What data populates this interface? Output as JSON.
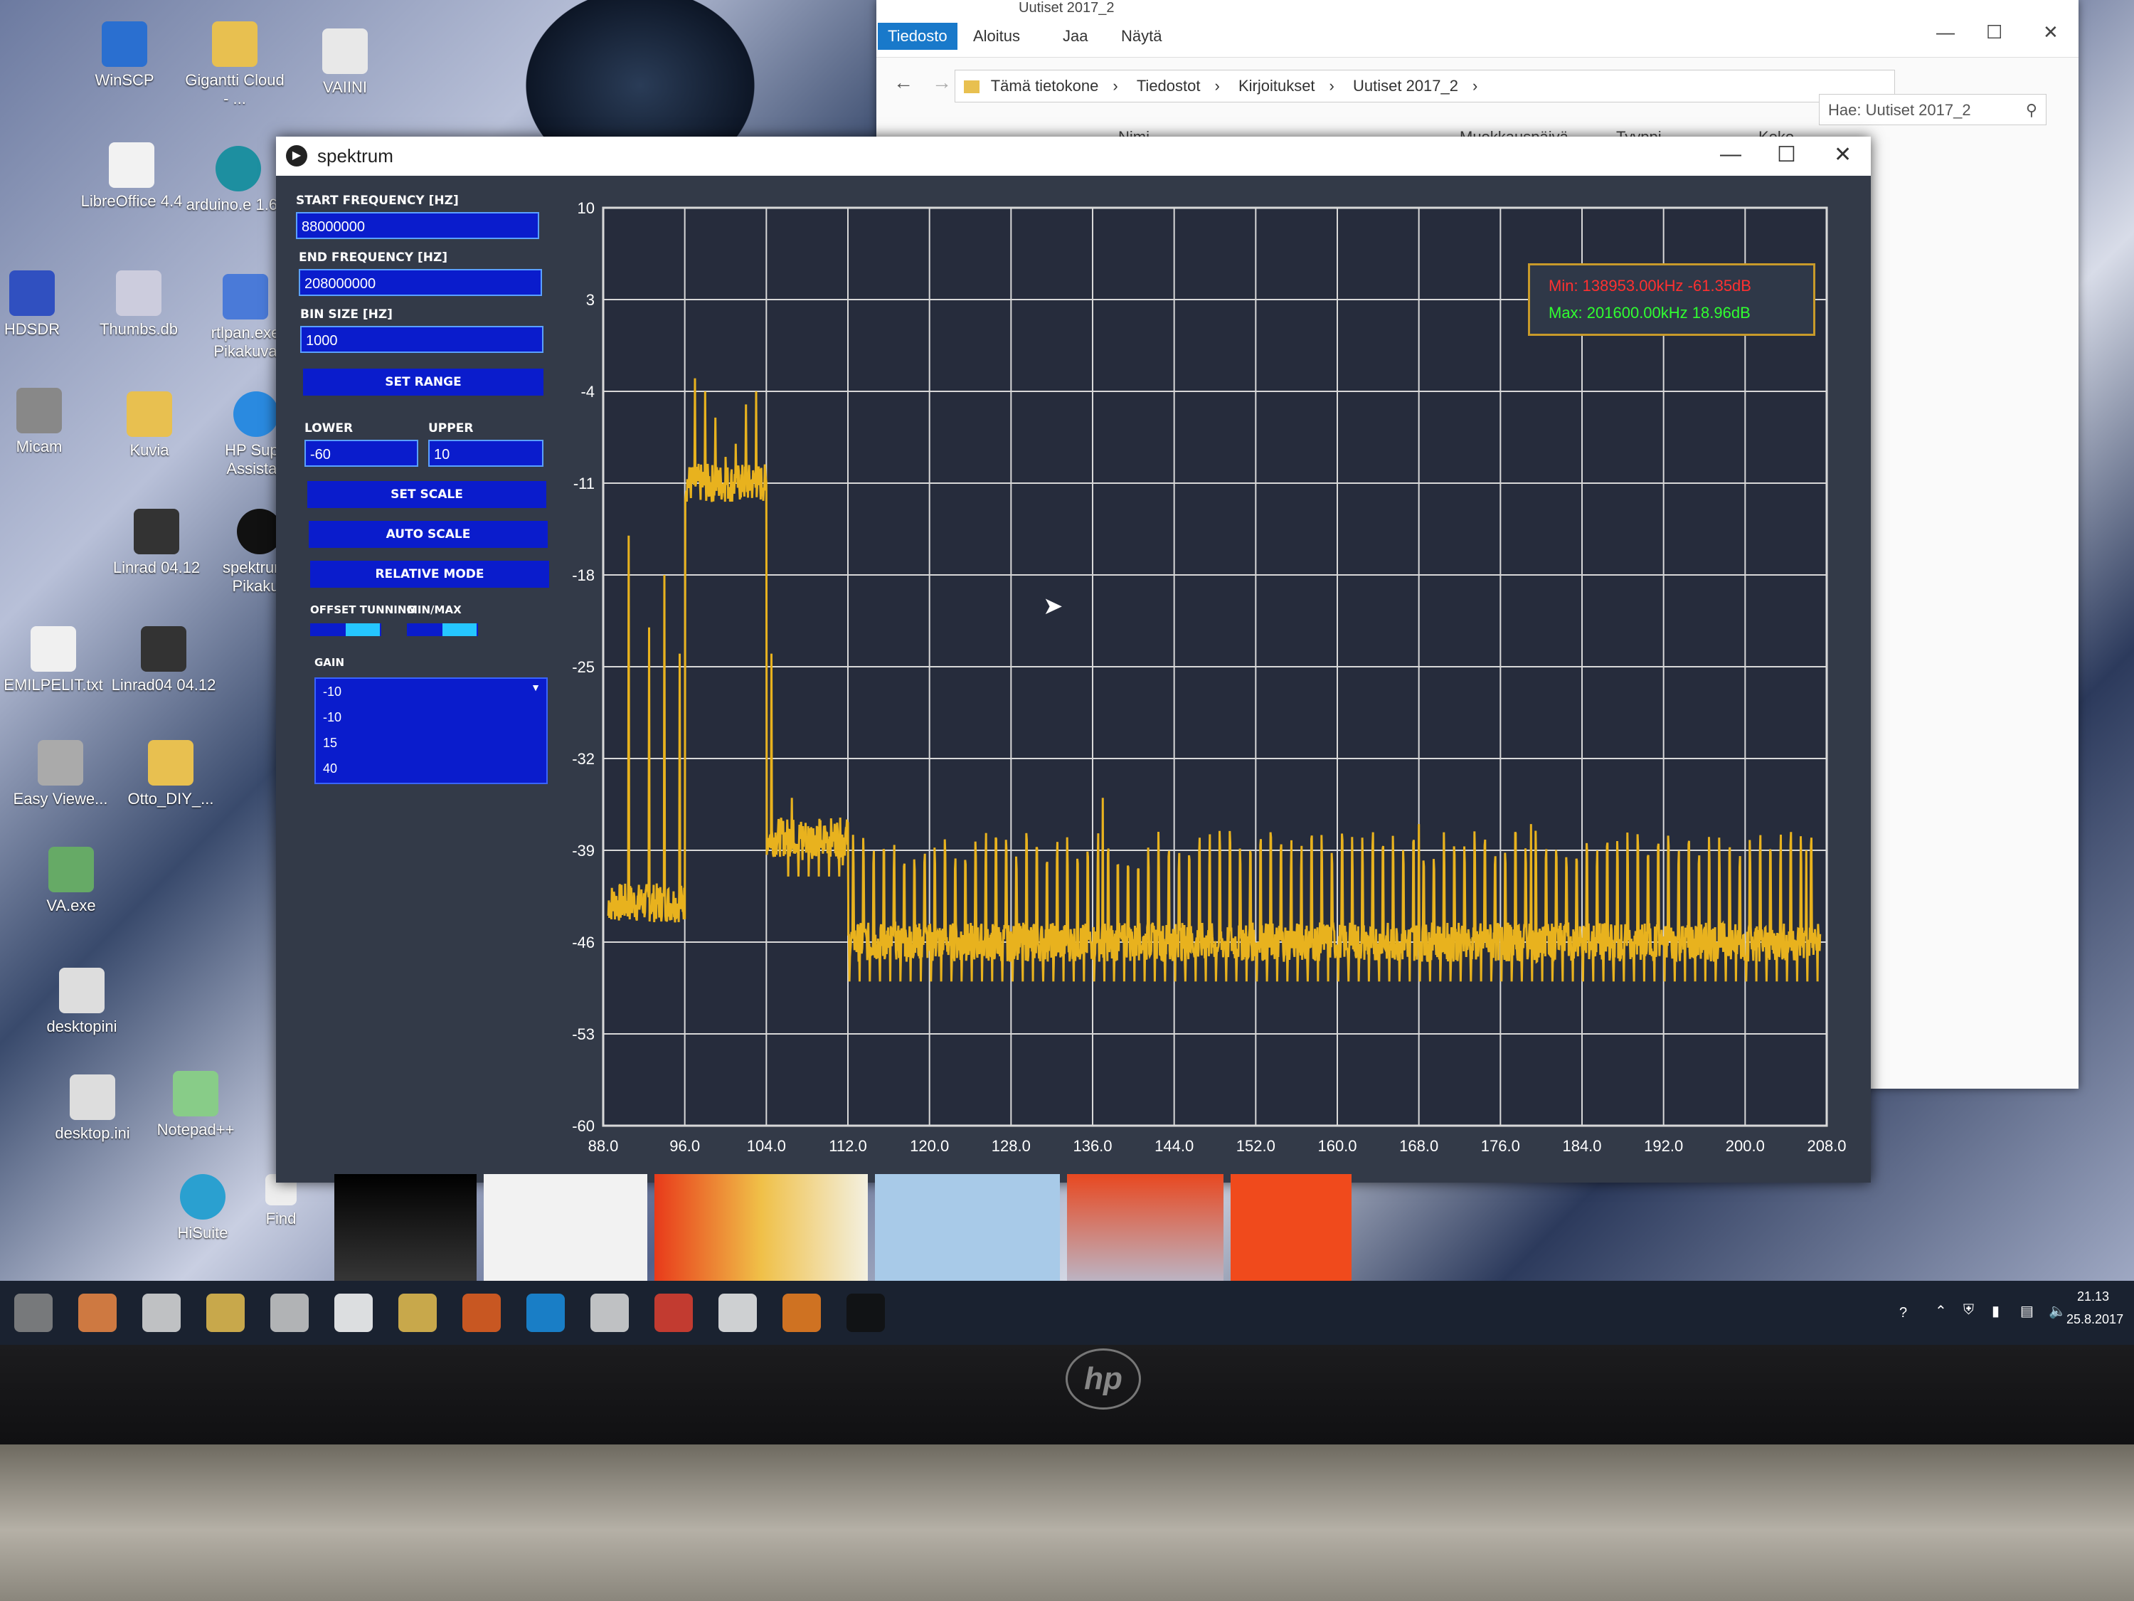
{
  "desktop": {
    "icons": [
      {
        "label": "WinSCP"
      },
      {
        "label": "Gigantti Cloud - ..."
      },
      {
        "label": "VAIINI"
      },
      {
        "label": "LibreOffice 4.4"
      },
      {
        "label": "arduino.e 1.6.1"
      },
      {
        "label": "HDSDR"
      },
      {
        "label": "Thumbs.db"
      },
      {
        "label": "rtlpan.exe Pikakuva"
      },
      {
        "label": "Micam"
      },
      {
        "label": "Kuvia"
      },
      {
        "label": "HP Supp Assistan"
      },
      {
        "label": "Linrad 04.12"
      },
      {
        "label": "spektrum - Pikakuv"
      },
      {
        "label": "EMILPELIT.txt"
      },
      {
        "label": "Linrad04 04.12"
      },
      {
        "label": "Easy Viewe..."
      },
      {
        "label": "Otto_DIY_..."
      },
      {
        "label": "VA.exe"
      },
      {
        "label": "desktopini"
      },
      {
        "label": "desktop.ini"
      },
      {
        "label": "Notepad++"
      },
      {
        "label": "HiSuite"
      },
      {
        "label": "Find"
      }
    ]
  },
  "explorer": {
    "title": "Uutiset 2017_2",
    "tabs": [
      "Tiedosto",
      "Aloitus",
      "Jaa",
      "Näytä"
    ],
    "breadcrumb": [
      "Tämä tietokone",
      "Tiedostot",
      "Kirjoitukset",
      "Uutiset 2017_2"
    ],
    "search_placeholder": "Hae: Uutiset 2017_2",
    "columns": [
      "Nimi",
      "Muokkauspäivä",
      "Tyyppi",
      "Koko"
    ]
  },
  "spektrum": {
    "title": "spektrum",
    "controls": {
      "start_freq_label": "START FREQUENCY [HZ]",
      "start_freq_value": "88000000",
      "end_freq_label": "END FREQUENCY [HZ]",
      "end_freq_value": "208000000",
      "bin_size_label": "BIN SIZE [HZ]",
      "bin_size_value": "1000",
      "set_range": "SET RANGE",
      "lower_label": "LOWER",
      "lower_value": "-60",
      "upper_label": "UPPER",
      "upper_value": "10",
      "set_scale": "SET SCALE",
      "auto_scale": "AUTO SCALE",
      "relative_mode": "RELATIVE MODE",
      "offset_tuning_label": "OFFSET TUNNING",
      "offset_tuning_on": false,
      "minmax_label": "MIN/MAX",
      "minmax_on": true,
      "gain_label": "GAIN",
      "gain_options": [
        "-10",
        "-10",
        "15",
        "40"
      ]
    },
    "legend": {
      "min": "Min: 138953.00kHz -61.35dB",
      "max": "Max: 201600.00kHz 18.96dB",
      "min_color": "#ff3030",
      "max_color": "#30ff30"
    }
  },
  "chart_data": {
    "type": "line",
    "series_color": "#e8b21e",
    "xlim": [
      88.0,
      208.0
    ],
    "ylim": [
      -60,
      10
    ],
    "x_ticks": [
      "88.0",
      "96.0",
      "104.0",
      "112.0",
      "120.0",
      "128.0",
      "136.0",
      "144.0",
      "152.0",
      "160.0",
      "168.0",
      "176.0",
      "184.0",
      "192.0",
      "200.0",
      "208.0"
    ],
    "y_ticks": [
      "10",
      "3",
      "-4",
      "-11",
      "-18",
      "-25",
      "-32",
      "-39",
      "-46",
      "-53",
      "-60"
    ],
    "grid": true,
    "peaks": [
      {
        "x": 88.5,
        "y": -44
      },
      {
        "x": 90.5,
        "y": -15
      },
      {
        "x": 92.5,
        "y": -22
      },
      {
        "x": 94.0,
        "y": -18
      },
      {
        "x": 95.5,
        "y": -24
      },
      {
        "x": 97.0,
        "y": -3
      },
      {
        "x": 98.0,
        "y": -4
      },
      {
        "x": 99.0,
        "y": -6
      },
      {
        "x": 100.0,
        "y": -9
      },
      {
        "x": 101.0,
        "y": -8
      },
      {
        "x": 102.0,
        "y": -5
      },
      {
        "x": 103.0,
        "y": -4
      },
      {
        "x": 104.5,
        "y": -24
      },
      {
        "x": 106.5,
        "y": -35
      },
      {
        "x": 137.0,
        "y": -35
      },
      {
        "x": 168.0,
        "y": -37
      },
      {
        "x": 179.0,
        "y": -37
      },
      {
        "x": 206.0,
        "y": -39
      }
    ],
    "segments": [
      {
        "x_from": 88.0,
        "x_to": 96.0,
        "floor": -43
      },
      {
        "x_from": 96.0,
        "x_to": 104.0,
        "floor": -11
      },
      {
        "x_from": 104.0,
        "x_to": 112.0,
        "floor": -38
      },
      {
        "x_from": 112.0,
        "x_to": 208.0,
        "floor": -46
      }
    ],
    "period": 1.0
  },
  "taskbar": {
    "clock_time": "21.13",
    "clock_date": "25.8.2017",
    "items": [
      "task-view-icon",
      "photos-icon",
      "camera-icon",
      "file-explorer-icon",
      "store-icon",
      "hp-icon",
      "files-icon",
      "chart-app-icon",
      "edge-icon",
      "mail-icon",
      "chrome-icon",
      "folder-icon",
      "firefox-icon",
      "spektrum-icon"
    ]
  }
}
